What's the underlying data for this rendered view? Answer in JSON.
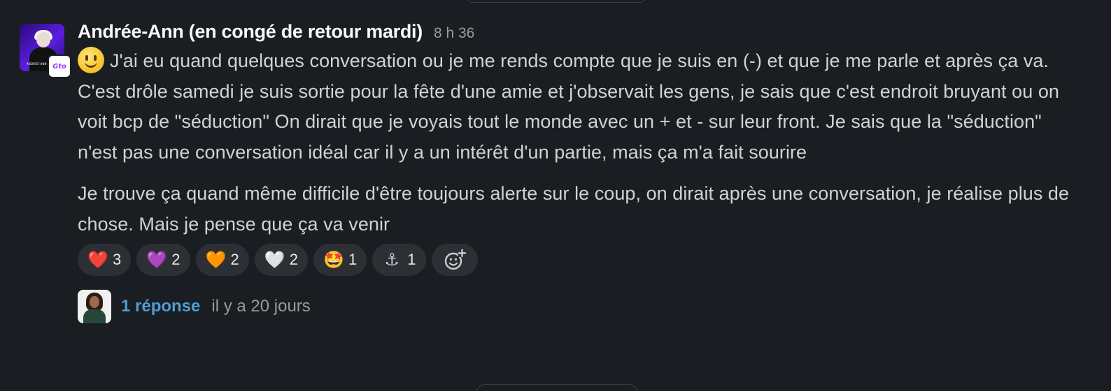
{
  "message": {
    "author": "Andrée-Ann (en congé de retour mardi)",
    "timestamp": "8 h 36",
    "avatar_badge": "Gto",
    "avatar_caption": "ANDRÉE-ANN",
    "leading_emoji": "slightly-smiling-face",
    "paragraphs": [
      "J'ai eu quand quelques conversation ou je me rends compte que je suis en (-) et que je me parle et après ça va.",
      "C'est drôle samedi je suis sortie pour la fête d'une amie et j'observait les gens, je sais que c'est endroit bruyant ou on voit bcp de \"séduction\" On dirait que je voyais tout le monde avec un + et - sur leur front. Je sais que la \"séduction\" n'est pas une conversation idéal car il y a un intérêt d'un partie, mais ça m'a fait  sourire",
      "Je trouve ça quand même difficile d'être toujours alerte sur le coup, on dirait après une conversation, je réalise plus de chose. Mais je pense que ça va venir"
    ]
  },
  "reactions": [
    {
      "emoji": "❤️",
      "name": "red-heart",
      "count": "3"
    },
    {
      "emoji": "💜",
      "name": "purple-heart",
      "count": "2"
    },
    {
      "emoji": "🧡",
      "name": "orange-heart",
      "count": "2"
    },
    {
      "emoji": "🤍",
      "name": "white-heart",
      "count": "2"
    },
    {
      "emoji": "🤩",
      "name": "star-struck",
      "count": "1"
    },
    {
      "emoji": "⚓",
      "name": "anchor",
      "count": "1"
    }
  ],
  "add_reaction_icon": "add-reaction-icon",
  "thread": {
    "reply_count": "1 réponse",
    "last_reply": "il y a 20 jours"
  },
  "colors": {
    "background": "#1a1d21",
    "text": "#d1d2d3",
    "link": "#4e9dd6",
    "muted": "#9a9b9d",
    "reaction_bg": "#2c2f33"
  }
}
